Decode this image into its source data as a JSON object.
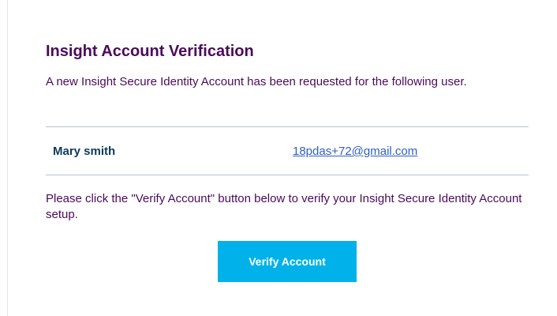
{
  "email_card": {
    "title": "Insight Account Verification",
    "intro_text": "A new Insight Secure Identity Account has been requested for the following user.",
    "user": {
      "name": "Mary smith",
      "email": "18pdas+72@gmail.com"
    },
    "instructions_text": "Please click the \"Verify Account\" button below to verify your Insight Secure Identity Account setup.",
    "verify_button_label": "Verify Account"
  },
  "colors": {
    "title": "#4b0a5c",
    "body_text": "#4b0a5c",
    "user_name": "#0b3b5c",
    "link": "#2f5fc2",
    "button_bg": "#00b2e9",
    "button_text": "#ffffff",
    "divider": "#b7c4cf"
  }
}
